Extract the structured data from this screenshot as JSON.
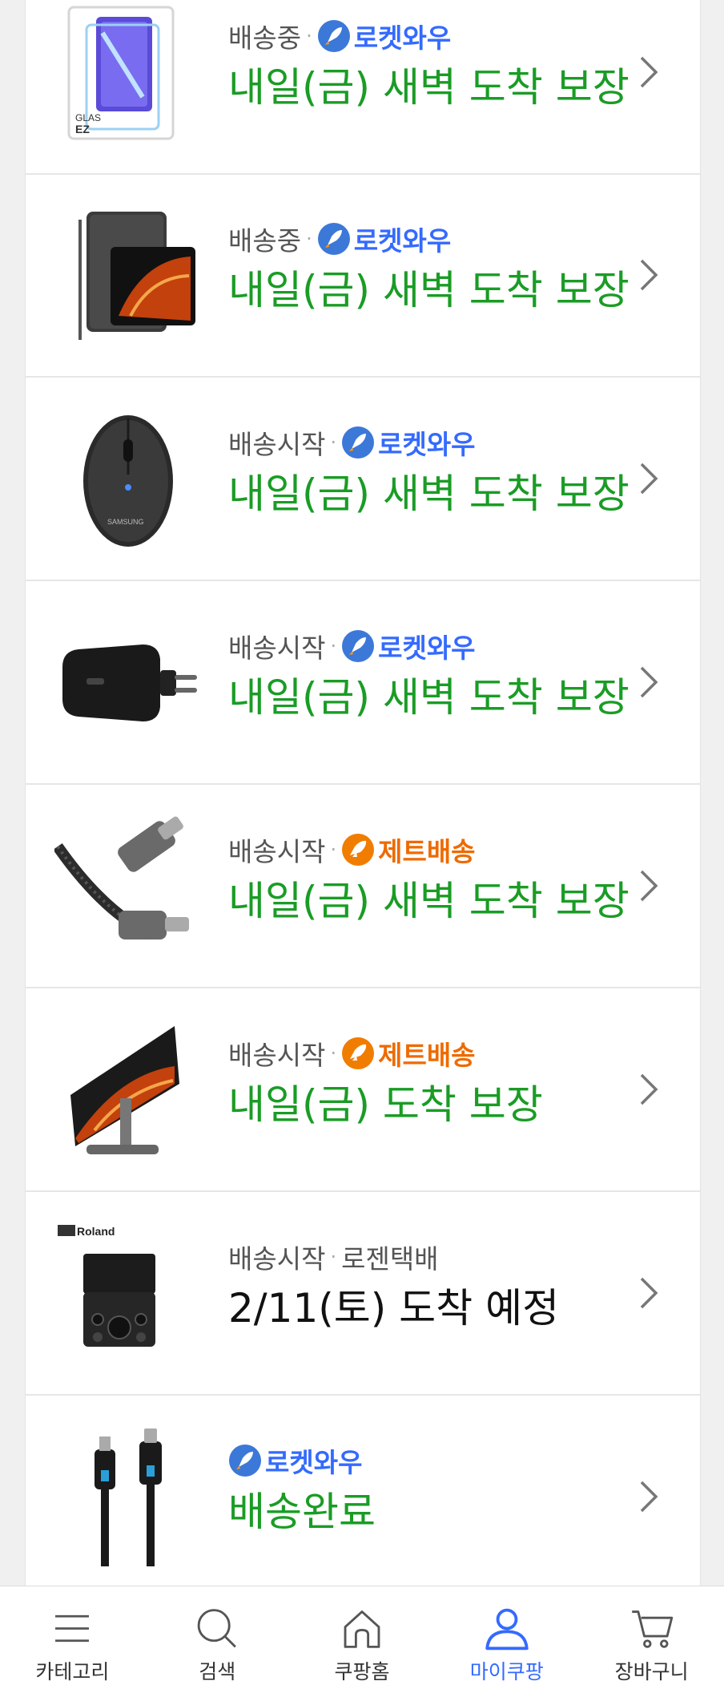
{
  "items": [
    {
      "status": "배송중",
      "carrier": "로켓와우",
      "carrier_type": "rocket",
      "eta": "내일(금) 새벽 도착 보장",
      "product_icon": "screen-protector-icon"
    },
    {
      "status": "배송중",
      "carrier": "로켓와우",
      "carrier_type": "rocket",
      "eta": "내일(금) 새벽 도착 보장",
      "product_icon": "tablet-icon"
    },
    {
      "status": "배송시작",
      "carrier": "로켓와우",
      "carrier_type": "rocket",
      "eta": "내일(금) 새벽 도착 보장",
      "product_icon": "mouse-icon"
    },
    {
      "status": "배송시작",
      "carrier": "로켓와우",
      "carrier_type": "rocket",
      "eta": "내일(금) 새벽 도착 보장",
      "product_icon": "charger-icon"
    },
    {
      "status": "배송시작",
      "carrier": "제트배송",
      "carrier_type": "jet",
      "eta": "내일(금) 새벽 도착 보장",
      "product_icon": "usb-c-cable-icon"
    },
    {
      "status": "배송시작",
      "carrier": "제트배송",
      "carrier_type": "jet",
      "eta": "내일(금) 도착 보장",
      "product_icon": "tablet-stand-icon"
    },
    {
      "status": "배송시작",
      "carrier": "로젠택배",
      "carrier_type": "plain",
      "eta": "2/11(토) 도착 예정",
      "product_icon": "audio-interface-icon",
      "brand_text": "Roland"
    },
    {
      "status": "",
      "carrier": "로켓와우",
      "carrier_type": "rocket",
      "eta": "배송완료",
      "product_icon": "micro-usb-cable-icon"
    }
  ],
  "tabbar": {
    "tabs": [
      {
        "label": "카테고리",
        "icon": "menu-icon"
      },
      {
        "label": "검색",
        "icon": "search-icon"
      },
      {
        "label": "쿠팡홈",
        "icon": "home-icon"
      },
      {
        "label": "마이쿠팡",
        "icon": "person-icon"
      },
      {
        "label": "장바구니",
        "icon": "cart-icon"
      }
    ],
    "active_index": 3
  },
  "colors": {
    "eta_green": "#1a9c25",
    "rocket_blue": "#346aff",
    "jet_orange": "#ee6a00",
    "active_tab": "#346aff"
  }
}
